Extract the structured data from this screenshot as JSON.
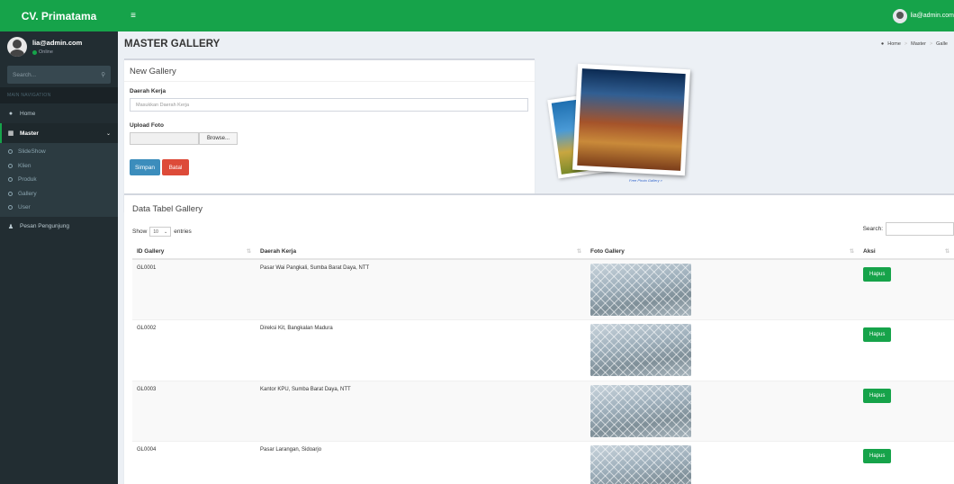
{
  "header": {
    "brand": "CV. Primatama",
    "menu_toggle": "≡",
    "user_email": "lia@admin.com"
  },
  "sidebar": {
    "user_name": "lia@admin.com",
    "user_status": "Online",
    "search_placeholder": "Search...",
    "nav_header": "MAIN NAVIGATION",
    "items": [
      {
        "label": "Home",
        "icon": "dashboard-icon"
      },
      {
        "label": "Master",
        "icon": "table-icon"
      },
      {
        "label": "Pesan Pengunjung",
        "icon": "user-icon"
      }
    ],
    "subitems": [
      {
        "label": "SlideShow"
      },
      {
        "label": "Klien"
      },
      {
        "label": "Produk"
      },
      {
        "label": "Gallery"
      },
      {
        "label": "User"
      }
    ]
  },
  "page": {
    "title": "MASTER GALLERY",
    "breadcrumb": [
      "Home",
      "Master",
      "Galle"
    ]
  },
  "form": {
    "title": "New Gallery",
    "field_label": "Daerah Kerja",
    "field_placeholder": "Masukkan Daerah Kerja",
    "upload_label": "Upload Foto",
    "browse_label": "Browse...",
    "save_label": "Simpan",
    "cancel_label": "Batal",
    "photo_caption": "Free Photo Gallery »"
  },
  "table": {
    "title": "Data Tabel Gallery",
    "show_label": "Show",
    "page_length": "10",
    "entries_label": "entries",
    "search_label": "Search:",
    "columns": [
      "ID Gallery",
      "Daerah Kerja",
      "Foto Gallery",
      "Aksi"
    ],
    "rows": [
      {
        "id": "GL0001",
        "daerah": "Pasar Wai Pangkali, Sumba Barat Daya, NTT",
        "action": "Hapus"
      },
      {
        "id": "GL0002",
        "daerah": "Direksi Kit, Bangkalan Madura",
        "action": "Hapus"
      },
      {
        "id": "GL0003",
        "daerah": "Kantor KPU, Sumba Barat Daya, NTT",
        "action": "Hapus"
      },
      {
        "id": "GL0004",
        "daerah": "Pasar Larangan, Sidoarjo",
        "action": "Hapus"
      }
    ]
  },
  "colors": {
    "brand_green": "#16a34a",
    "sidebar_bg": "#222d32",
    "primary_blue": "#3c8dbc",
    "danger_red": "#dd4b39"
  }
}
